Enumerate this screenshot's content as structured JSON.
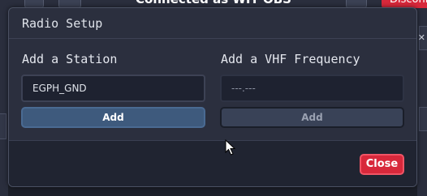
{
  "background": {
    "title": "Connected as WIT OBS",
    "right_button_label": "Disconn"
  },
  "modal": {
    "title": "Radio Setup",
    "station": {
      "label": "Add a Station",
      "value": "EGPH_GND",
      "button_label": "Add"
    },
    "frequency": {
      "label": "Add a VHF Frequency",
      "placeholder": "---.---",
      "button_label": "Add"
    },
    "close_label": "Close"
  },
  "colors": {
    "primary_button": "#3e5a7d",
    "close_button": "#d8283b",
    "modal_bg": "#2b2f3e"
  }
}
